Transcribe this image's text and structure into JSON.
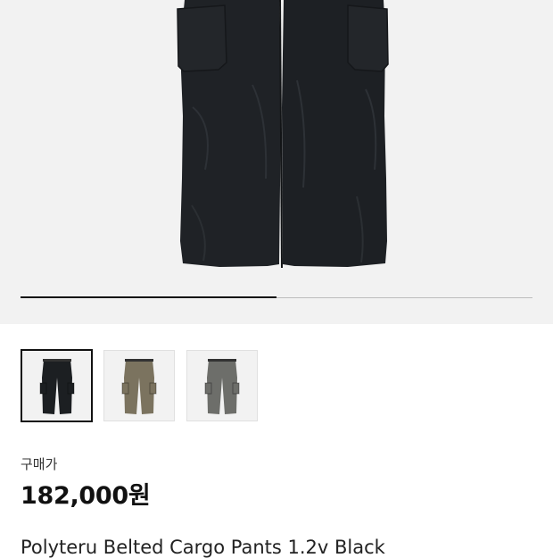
{
  "product": {
    "price_label": "구매가",
    "price": "182,000원",
    "title": "Polyteru Belted Cargo Pants 1.2v Black"
  },
  "gallery": {
    "image_count": 2,
    "current_index": 1,
    "progress_fraction": 0.5
  },
  "variants": [
    {
      "name": "black-variant-thumb",
      "color": "#1c1f22",
      "selected": true
    },
    {
      "name": "khaki-variant-thumb",
      "color": "#7b735f",
      "selected": false
    },
    {
      "name": "grey-variant-thumb",
      "color": "#6d6e6a",
      "selected": false
    }
  ],
  "colors": {
    "hero_background": "#f2f2f2",
    "pants_black": "#1c1f22"
  }
}
